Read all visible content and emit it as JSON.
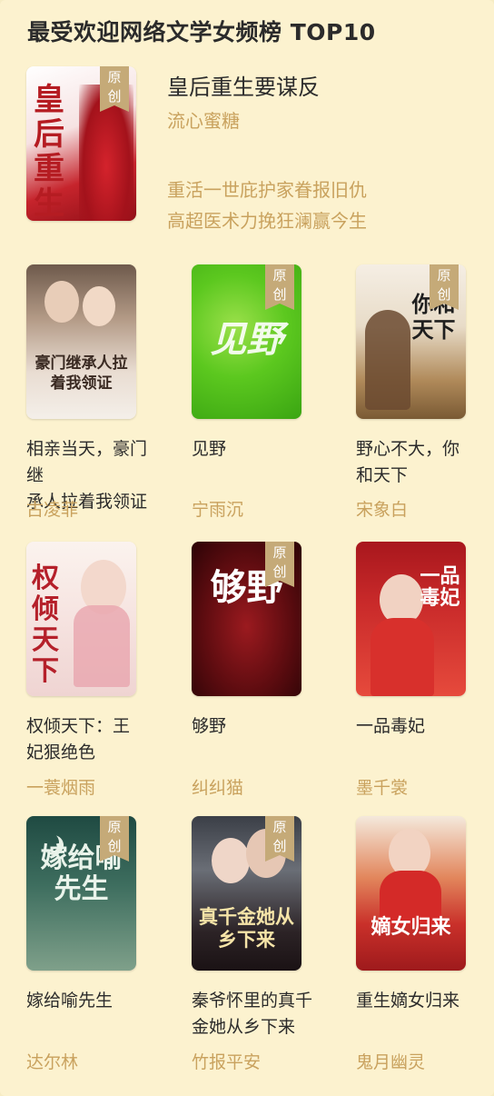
{
  "header": {
    "title": "最受欢迎网络文学女频榜 TOP10"
  },
  "badge": {
    "line1": "原",
    "line2": "创"
  },
  "top_book": {
    "title": "皇后重生要谋反",
    "author": "流心蜜糖",
    "desc_line1": "重活一世庇护家眷报旧仇",
    "desc_line2": "高超医术力挽狂澜赢今生",
    "cover_text": "皇后重生"
  },
  "books": [
    {
      "title": "相亲当天，豪门继承人拉着我领证",
      "line1": "相亲当天，豪门继",
      "line2": "承人拉着我领证",
      "author": "古凌菲",
      "original": false,
      "cover_text": "豪门继承人拉着我领证"
    },
    {
      "title": "见野",
      "line1": "见野",
      "line2": "",
      "author": "宁雨沉",
      "original": true,
      "cover_text": "见野"
    },
    {
      "title": "野心不大，你和天下",
      "line1": "野心不大，你",
      "line2": "和天下",
      "author": "宋象白",
      "original": true,
      "cover_text": "你和天下"
    },
    {
      "title": "权倾天下：王妃狠绝色",
      "line1": "权倾天下：王",
      "line2": "妃狠绝色",
      "author": "一蓑烟雨",
      "original": false,
      "cover_text": "权倾天下"
    },
    {
      "title": "够野",
      "line1": "够野",
      "line2": "",
      "author": "纠纠猫",
      "original": true,
      "cover_text": "够野"
    },
    {
      "title": "一品毒妃",
      "line1": "一品毒妃",
      "line2": "",
      "author": "墨千裳",
      "original": false,
      "cover_text": "一品毒妃"
    },
    {
      "title": "嫁给喻先生",
      "line1": "嫁给喻先生",
      "line2": "",
      "author": "达尔林",
      "original": true,
      "cover_text": "嫁给喻先生"
    },
    {
      "title": "秦爷怀里的真千金她从乡下来",
      "line1": "秦爷怀里的真千",
      "line2": "金她从乡下来",
      "author": "竹报平安",
      "original": true,
      "cover_text": "真千金她从乡下来"
    },
    {
      "title": "重生嫡女归来",
      "line1": "重生嫡女归来",
      "line2": "",
      "author": "鬼月幽灵",
      "original": false,
      "cover_text": "嫡女归来"
    }
  ],
  "colors": {
    "background": "#fcf2cf",
    "accent": "#c9a25e",
    "badge": "#c5aa78",
    "title": "#2b2b2b"
  }
}
